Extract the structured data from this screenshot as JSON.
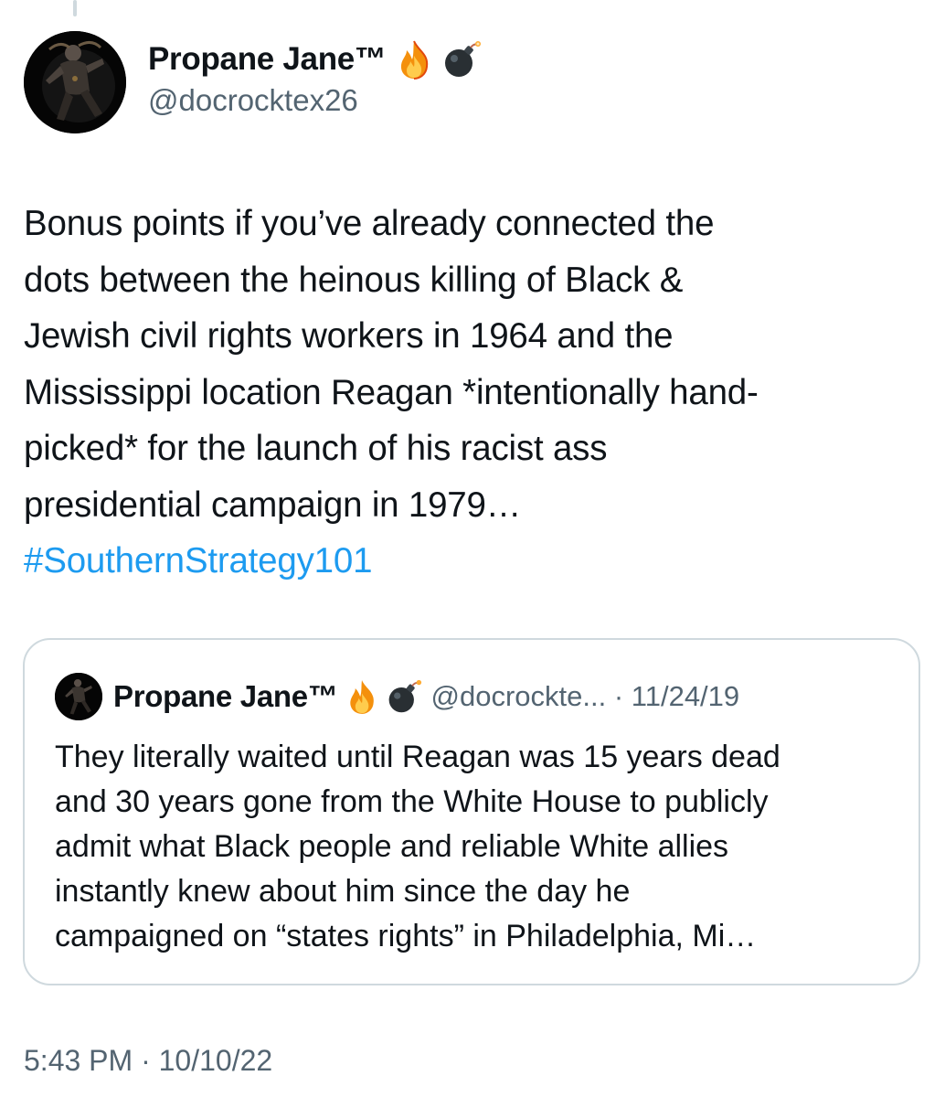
{
  "tweet": {
    "author": {
      "name": "Propane Jane™",
      "handle": "@docrocktex26",
      "emoji": [
        "fire-emoji",
        "bomb-emoji"
      ]
    },
    "text_lines": [
      "Bonus points if you’ve already connected the",
      "dots between the heinous killing of Black &",
      "Jewish civil rights workers in 1964 and the",
      "Mississippi location Reagan *intentionally hand-",
      "picked* for the launch of his racist ass",
      "presidential campaign in 1979…"
    ],
    "hashtag": "#SouthernStrategy101",
    "timestamp": "5:43 PM · 10/10/22"
  },
  "quoted_tweet": {
    "author_name": "Propane Jane™",
    "handle_date": "@docrockte... · 11/24/19",
    "emoji": [
      "fire-emoji",
      "bomb-emoji"
    ],
    "text_lines": [
      "They literally waited until Reagan was 15 years dead",
      "and 30 years gone from the White House to publicly",
      "admit what Black people and reliable White allies",
      "instantly knew about him since the day he",
      "campaigned on “states rights” in Philadelphia, Mi…"
    ]
  },
  "colors": {
    "link": "#1d9bf0",
    "secondary_text": "#536471",
    "primary_text": "#0f1419",
    "border": "#cfd9de"
  }
}
